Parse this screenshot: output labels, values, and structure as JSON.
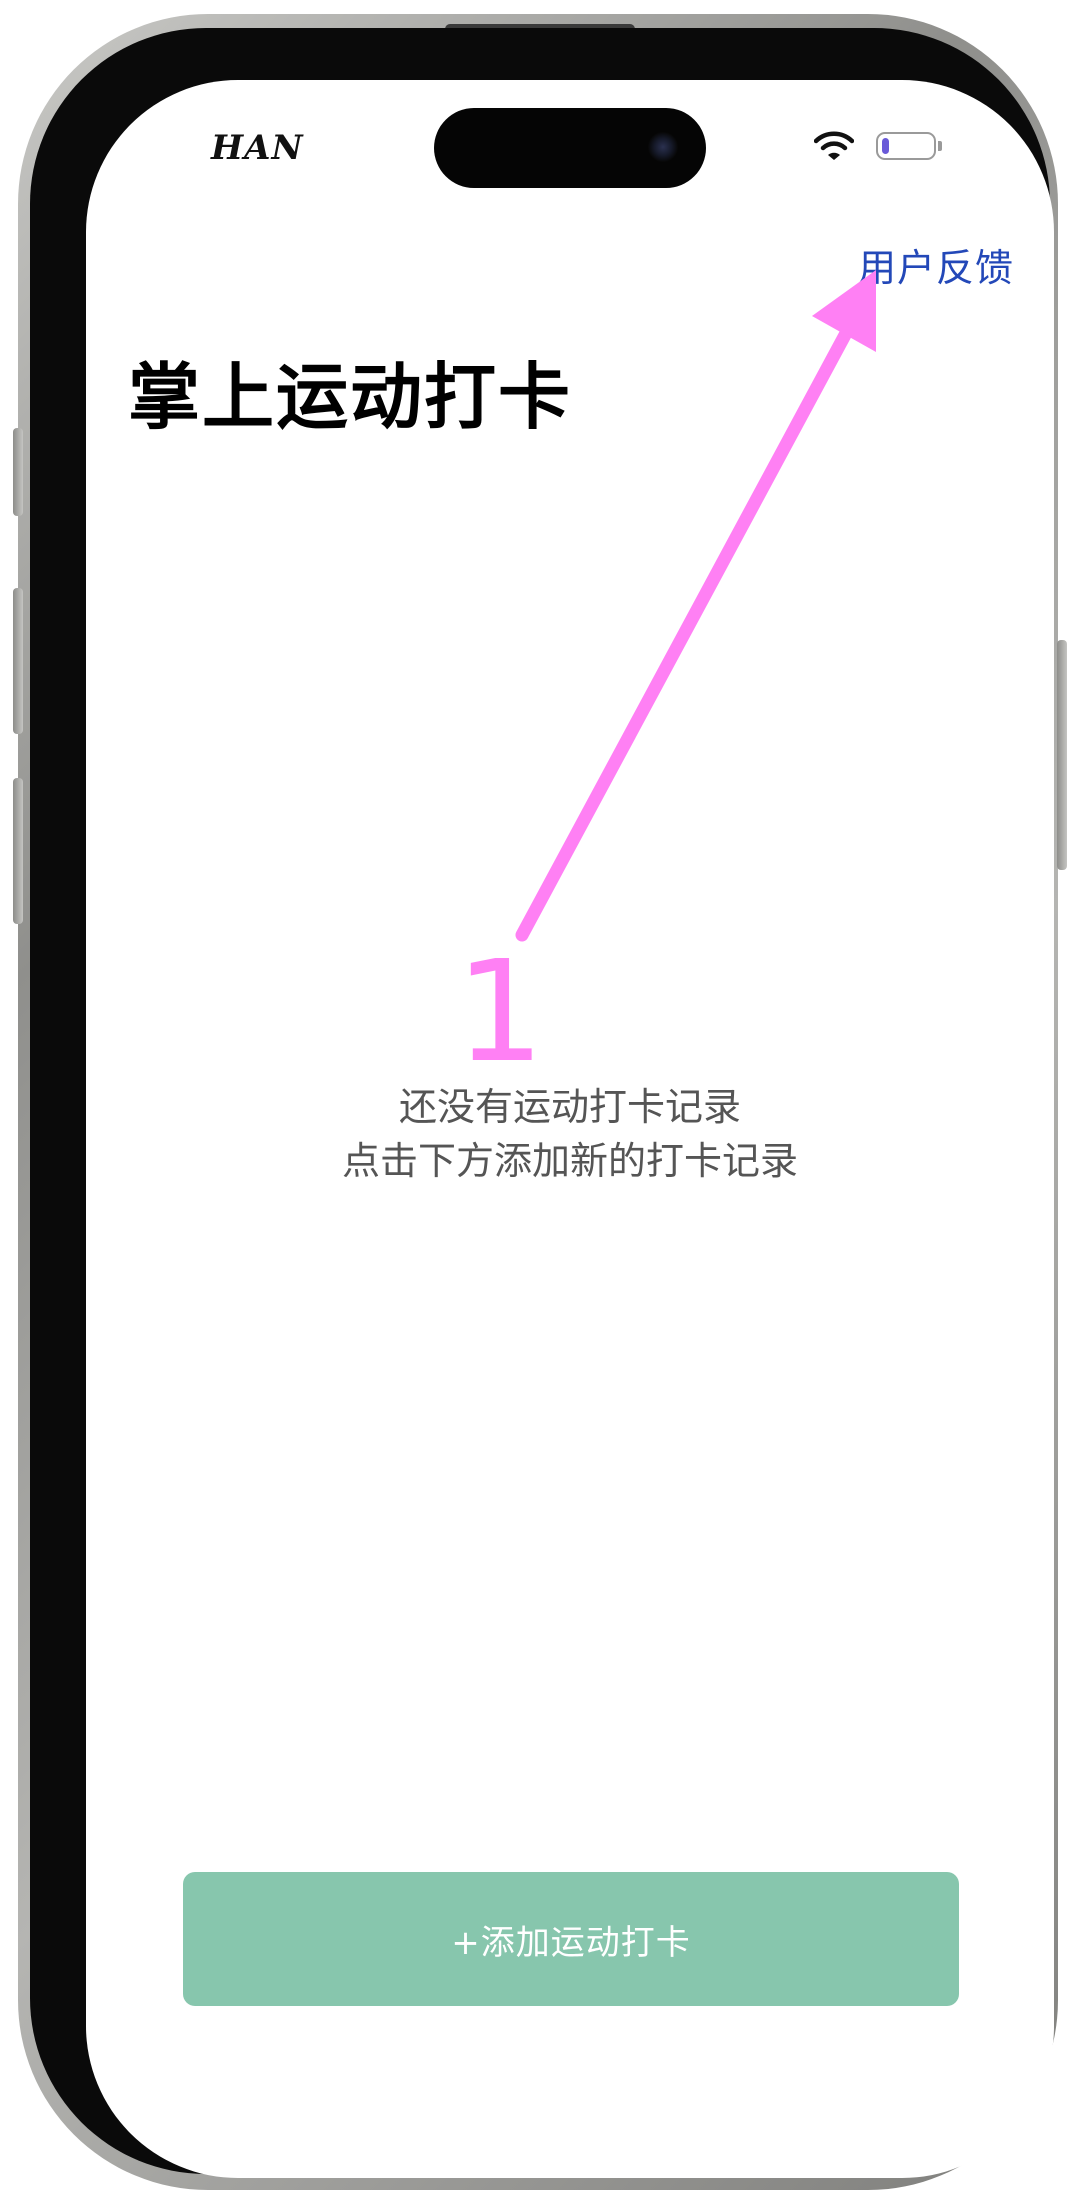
{
  "status_bar": {
    "carrier": "HAN",
    "battery_level": 0.15,
    "battery_color": "#6a5ad8"
  },
  "header": {
    "feedback_label": "用户反馈",
    "title": "掌上运动打卡"
  },
  "empty_state": {
    "line1": "还没有运动打卡记录",
    "line2": "点击下方添加新的打卡记录"
  },
  "actions": {
    "add_label": "+添加运动打卡"
  },
  "annotation": {
    "step_label": "1",
    "color": "#ff80f4"
  },
  "colors": {
    "accent_blue": "#2348b8",
    "button_green": "#87c6ad"
  }
}
